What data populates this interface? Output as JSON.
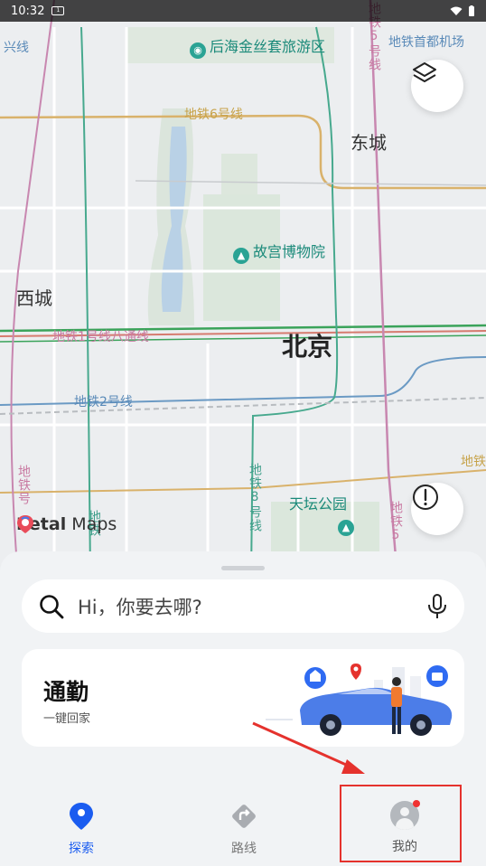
{
  "status_bar": {
    "time": "10:32",
    "app_icon_text": "1"
  },
  "map": {
    "labels": {
      "poi_houhai": "后海金丝套旅游区",
      "poi_palace": "故宫博物院",
      "poi_tiantan": "天坛公园",
      "district_dongcheng": "东城",
      "district_xicheng": "西城",
      "city_beijing": "北京",
      "metro_line6": "地铁6号线",
      "metro_line1": "地铁1号线八通线",
      "metro_line2": "地铁2号线",
      "metro_line5_top": "地铁5号线",
      "metro_line5_bottom": "地铁5",
      "metro_line8": "地铁8号线",
      "metro_capital_airport": "地铁首都机场",
      "metro_xing": "兴线",
      "metro_left_vertical": "地铁号",
      "metro_left_vertical2": "地铁",
      "metro_right_edge": "地铁"
    },
    "icons": {
      "layers": "layers-icon",
      "alert": "exclamation-icon"
    }
  },
  "logo": {
    "brand_bold": "Petal",
    "brand_rest": "Maps"
  },
  "search": {
    "placeholder": "Hi，你要去哪?"
  },
  "commute": {
    "title": "通勤",
    "subtitle": "一键回家"
  },
  "nav": {
    "explore": "探索",
    "route": "路线",
    "me": "我的",
    "active_color": "#1a5cf0",
    "inactive_color": "#777777"
  },
  "annotation": {
    "highlight_color": "#e5322d"
  }
}
